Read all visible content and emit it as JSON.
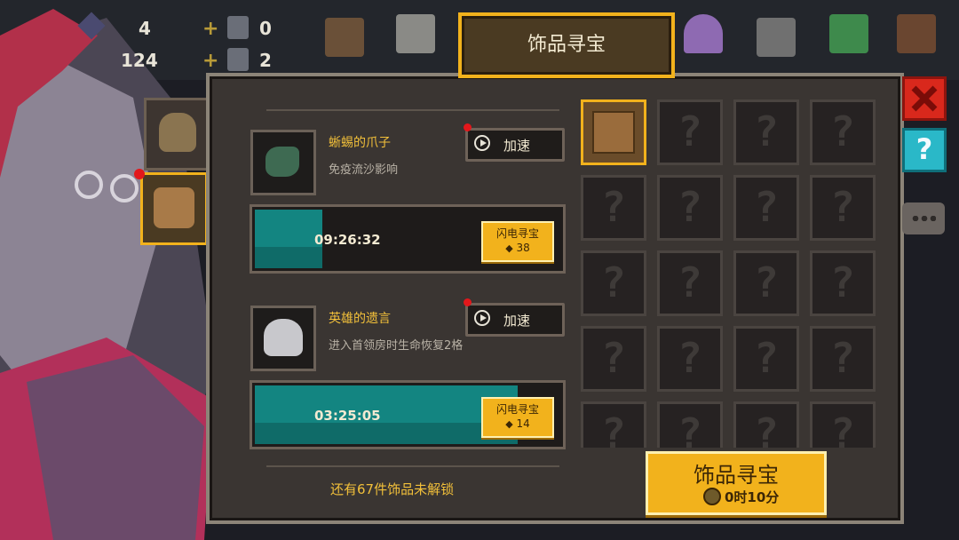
{
  "hud": {
    "gems_count": "4",
    "cells_count": "124",
    "resource1_count": "0",
    "resource2_count": "2"
  },
  "panel": {
    "title": "饰品寻宝"
  },
  "items": [
    {
      "name": "蜥蜴的爪子",
      "desc": "免疫流沙影响",
      "speed_label": "加速",
      "timer": "09:26:32",
      "progress": 0.22,
      "flash_label": "闪电寻宝",
      "flash_cost": "38"
    },
    {
      "name": "英雄的遗言",
      "desc": "进入首领房时生命恢复2格",
      "speed_label": "加速",
      "timer": "03:25:05",
      "progress": 0.86,
      "flash_label": "闪电寻宝",
      "flash_cost": "14"
    }
  ],
  "footer": {
    "locked_text": "还有67件饰品未解锁",
    "hunt_button": "饰品寻宝",
    "hunt_time": "0时10分"
  },
  "grid": {
    "unknown_symbol": "?"
  },
  "icons": {
    "close": "close-icon",
    "help": "help-icon",
    "chat": "chat-icon",
    "help_symbol": "?"
  },
  "colors": {
    "accent": "#f2b21c",
    "progress": "#0f6b68",
    "label": "#f2c03a"
  }
}
